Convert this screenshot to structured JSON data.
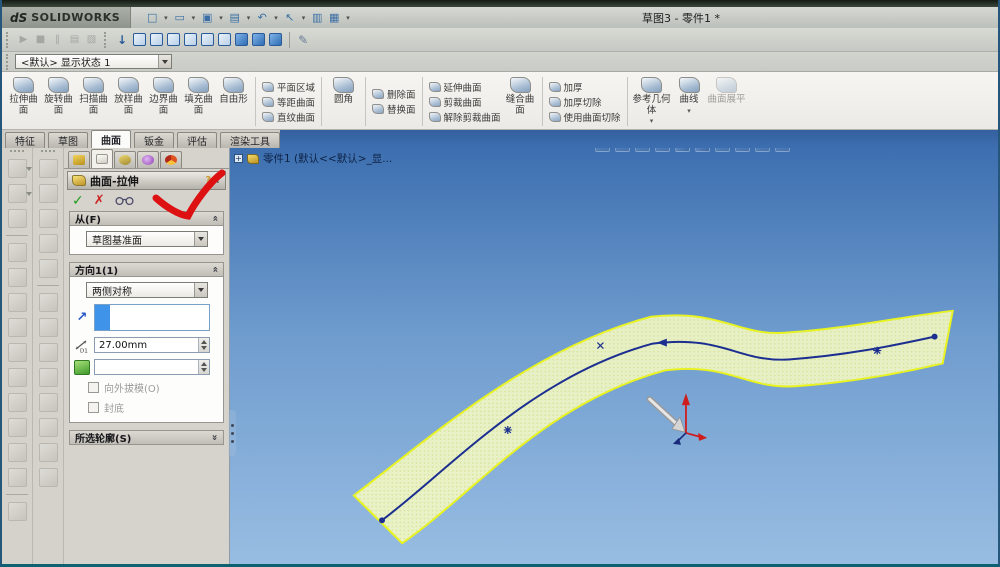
{
  "window": {
    "brand_mark": "dS",
    "brand_name": "SOLIDWORKS",
    "title": "草图3 - 零件1 *"
  },
  "display_state": {
    "value": "<默认> 显示状态 1"
  },
  "tabs": {
    "items": [
      "特征",
      "草图",
      "曲面",
      "钣金",
      "评估",
      "渲染工具"
    ],
    "active": "曲面"
  },
  "ribbon": {
    "extruded": "拉伸曲面",
    "revolved": "旋转曲面",
    "swept": "扫描曲面",
    "lofted": "放样曲面",
    "boundary": "边界曲面",
    "filled": "填充曲面",
    "freeform": "自由形",
    "planar": "平面区域",
    "offset": "等距曲面",
    "ruled": "直纹曲面",
    "fillet": "圆角",
    "delete_face": "删除面",
    "replace_face": "替换面",
    "extend": "延伸曲面",
    "trim": "剪裁曲面",
    "untrim": "解除剪裁曲面",
    "knit": "缝合曲面",
    "thicken": "加厚",
    "thicken_cut": "加厚切除",
    "cut_with_surface": "使用曲面切除",
    "ref_geometry": "参考几何体",
    "curves": "曲线",
    "flatten": "曲面展平"
  },
  "property_manager": {
    "title": "曲面-拉伸",
    "from": {
      "header": "从(F)",
      "value": "草图基准面"
    },
    "direction1": {
      "header": "方向1(1)",
      "end_condition": "两侧对称",
      "depth": "27.00mm",
      "draft": "",
      "draft_outward": "向外拔模(O)",
      "cap_end": "封底"
    },
    "contours": {
      "header": "所选轮廓(S)"
    }
  },
  "viewport": {
    "tree_label": "零件1 (默认<<默认>_显...",
    "colors": {
      "sky_top": "#3d6fb0",
      "sky_bottom": "#98bde2",
      "surface_fill": "#f1f6c3",
      "surface_edge": "#e9f41c",
      "spline": "#1c2f90",
      "annotation": "#dd1111",
      "triad": "#cf1d1d"
    }
  }
}
